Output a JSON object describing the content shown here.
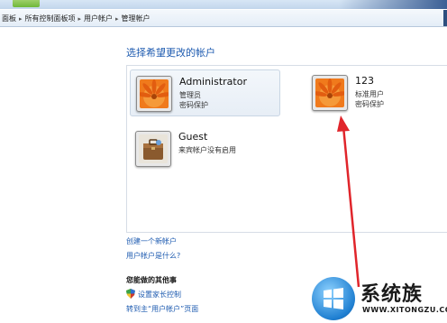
{
  "breadcrumb": {
    "items": [
      "面板",
      "所有控制面板项",
      "用户帐户",
      "管理帐户"
    ]
  },
  "page": {
    "heading": "选择希望更改的帐户"
  },
  "accounts": [
    {
      "name": "Administrator",
      "role": "管理员",
      "password": "密码保护",
      "avatar": "flower-avatar"
    },
    {
      "name": "123",
      "role": "标准用户",
      "password": "密码保护",
      "avatar": "flower-avatar"
    },
    {
      "name": "Guest",
      "role": "来宾帐户没有启用",
      "password": "",
      "avatar": "briefcase-avatar"
    }
  ],
  "links": {
    "create_account": "创建一个新帐户",
    "what_is_account": "用户帐户是什么?"
  },
  "other": {
    "title": "您能做的其他事",
    "parental_controls": "设置家长控制",
    "main_page": "转到主“用户帐户”页面"
  },
  "watermark": {
    "brand": "系统族",
    "url": "WWW.XITONGZU.COM"
  },
  "colors": {
    "link": "#1e5bb0",
    "arrow": "#e0252b",
    "avatar_orange": "#f07a1c"
  }
}
